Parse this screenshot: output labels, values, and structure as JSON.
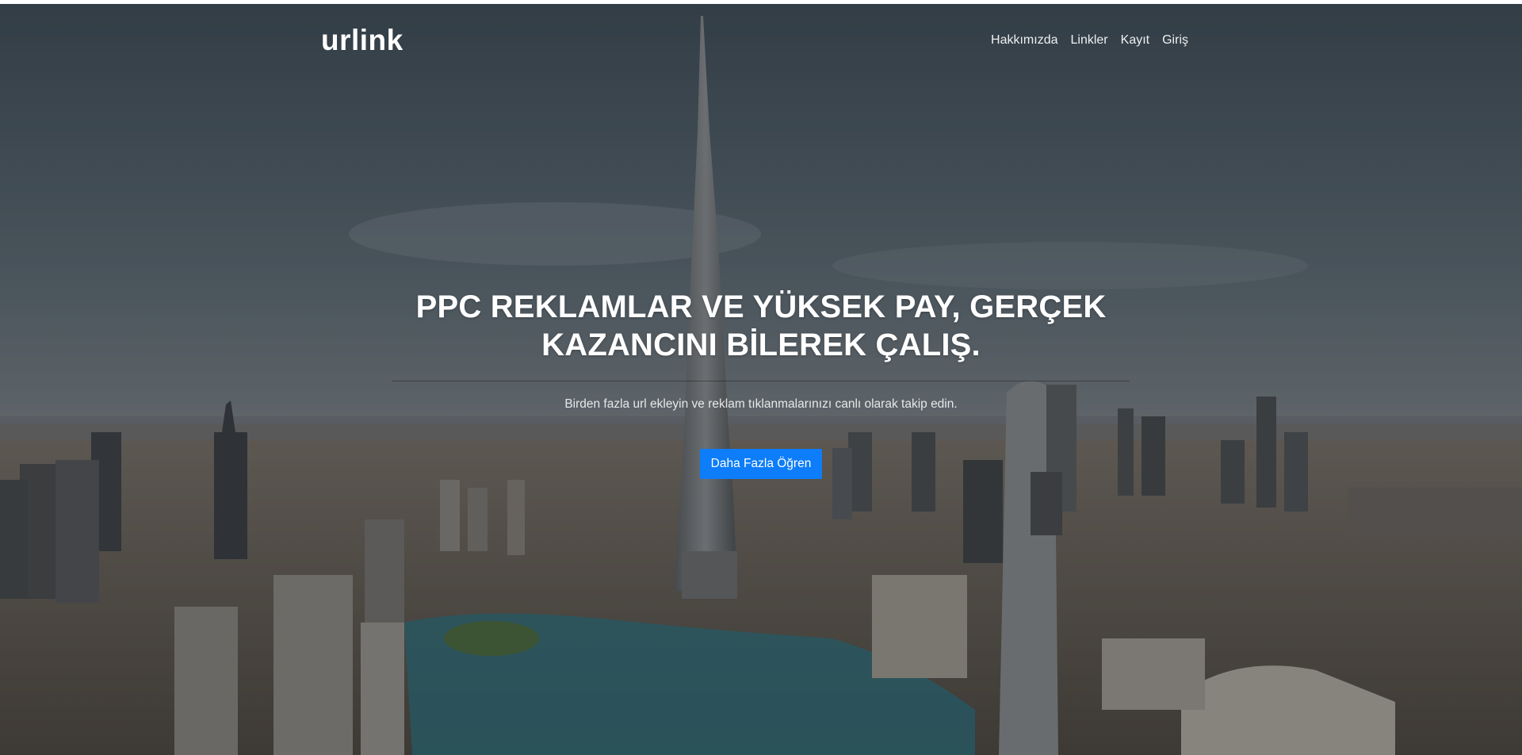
{
  "navbar": {
    "brand": "urlink",
    "links": [
      "Hakkımızda",
      "Linkler",
      "Kayıt",
      "Giriş"
    ]
  },
  "masthead": {
    "headline": "PPC REKLAMLAR VE YÜKSEK PAY, GERÇEK KAZANCINI BİLEREK ÇALIŞ.",
    "subtext": "Birden fazla url ekleyin ve reklam tıklanmalarınızı canlı olarak takip edin.",
    "cta_label": "Daha Fazla Öğren"
  },
  "colors": {
    "cta_background": "#0d7df9",
    "text": "#ffffff"
  },
  "background": {
    "description": "aerial-city-skyline-photo"
  }
}
